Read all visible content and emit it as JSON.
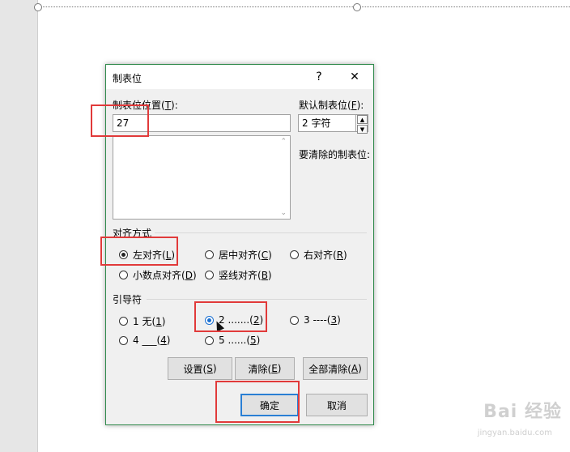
{
  "dialog": {
    "title": "制表位",
    "help": "?",
    "close": "✕"
  },
  "tab_position": {
    "label_main": "制表位位置(",
    "label_key": "T",
    "label_end": "):",
    "value": "27"
  },
  "default_tab": {
    "label_main": "默认制表位(",
    "label_key": "F",
    "label_end": "):",
    "value": "2 字符"
  },
  "to_clear_label": "要清除的制表位:",
  "alignment": {
    "label": "对齐方式",
    "options": [
      {
        "text": "左对齐(",
        "key": "L",
        "end": ")",
        "selected": true
      },
      {
        "text": "居中对齐(",
        "key": "C",
        "end": ")",
        "selected": false
      },
      {
        "text": "右对齐(",
        "key": "R",
        "end": ")",
        "selected": false
      },
      {
        "text": "小数点对齐(",
        "key": "D",
        "end": ")",
        "selected": false
      },
      {
        "text": "竖线对齐(",
        "key": "B",
        "end": ")",
        "selected": false
      }
    ]
  },
  "leader": {
    "label": "引导符",
    "options": [
      {
        "text": "1 无(",
        "key": "1",
        "end": ")",
        "selected": false
      },
      {
        "text": "2 .......(",
        "key": "2",
        "end": ")",
        "selected": true
      },
      {
        "text": "3 ----(",
        "key": "3",
        "end": ")",
        "selected": false
      },
      {
        "text": "4 ___(",
        "key": "4",
        "end": ")",
        "selected": false
      },
      {
        "text": "5 ......(",
        "key": "5",
        "end": ")",
        "selected": false
      }
    ]
  },
  "buttons": {
    "set": {
      "text": "设置(",
      "key": "S",
      "end": ")"
    },
    "clear": {
      "text": "清除(",
      "key": "E",
      "end": ")"
    },
    "clear_all": {
      "text": "全部清除(",
      "key": "A",
      "end": ")"
    },
    "ok": "确定",
    "cancel": "取消"
  },
  "watermark": {
    "brand": "Bai 经验",
    "url": "jingyan.baidu.com"
  }
}
